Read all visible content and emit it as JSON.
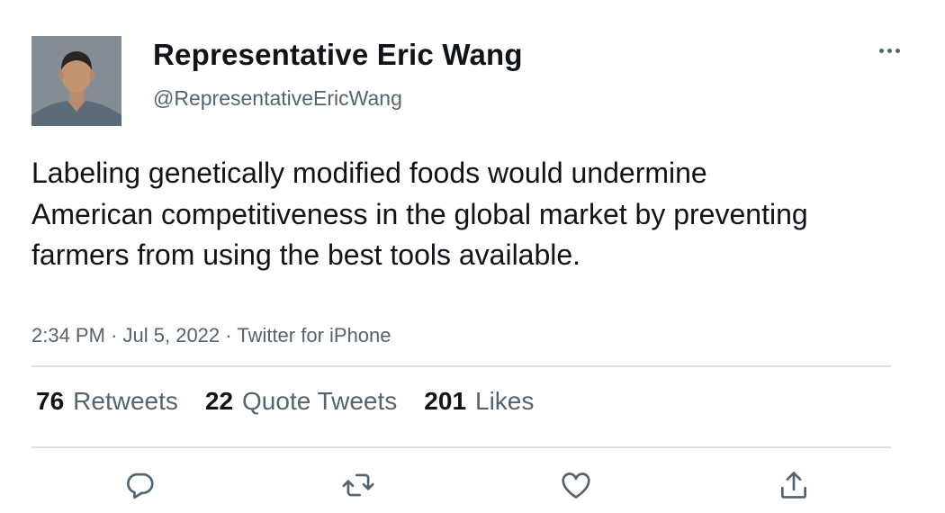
{
  "author": {
    "display_name": "Representative Eric Wang",
    "handle": "@RepresentativeEricWang",
    "avatar_icon": "avatar-photo"
  },
  "tweet": {
    "text": "Labeling genetically modified foods would undermine American competitiveness in the global market by preventing farmers from using the best tools available.",
    "time": "2:34 PM",
    "separator": "·",
    "date": "Jul 5, 2022",
    "source": "Twitter for iPhone"
  },
  "stats": {
    "retweets": {
      "count": "76",
      "label": "Retweets"
    },
    "quotes": {
      "count": "22",
      "label": "Quote Tweets"
    },
    "likes": {
      "count": "201",
      "label": "Likes"
    }
  },
  "actions": [
    {
      "name": "reply",
      "icon": "reply-icon"
    },
    {
      "name": "retweet",
      "icon": "retweet-icon"
    },
    {
      "name": "like",
      "icon": "heart-icon"
    },
    {
      "name": "share",
      "icon": "share-icon"
    }
  ],
  "colors": {
    "text_primary": "#0f1419",
    "text_secondary": "#536471",
    "divider": "#dadfe3",
    "icon": "#536471"
  }
}
